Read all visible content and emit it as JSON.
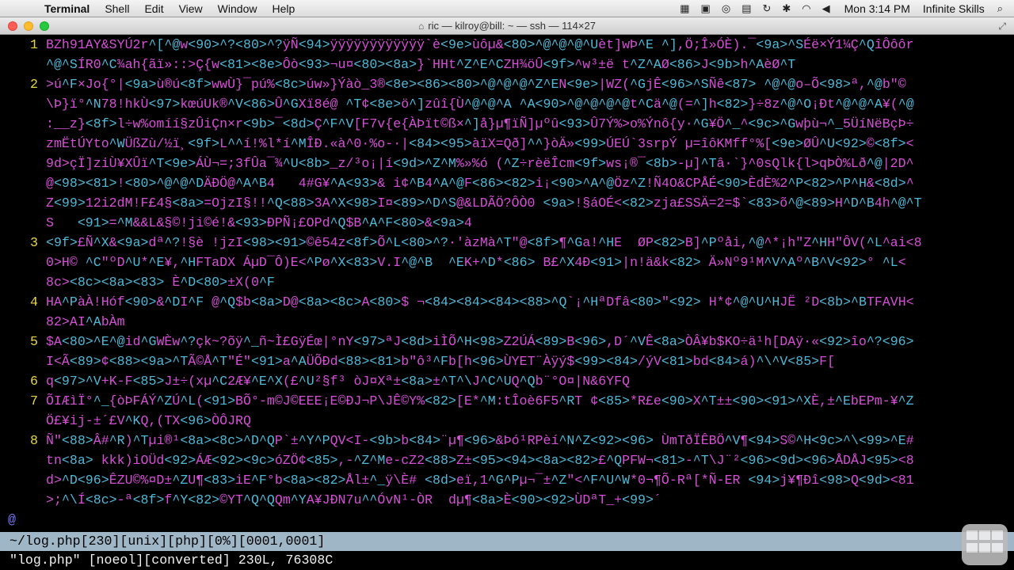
{
  "menubar": {
    "app": "Terminal",
    "items": [
      "Shell",
      "Edit",
      "View",
      "Window",
      "Help"
    ],
    "clock": "Mon 3:14 PM",
    "user": "Infinite Skills"
  },
  "window": {
    "title": "ric — kilroy@bill: ~ — ssh — 114×27"
  },
  "editor": {
    "lines": [
      {
        "n": "1",
        "text": "BZh91AY&SYÚ2r^[^@w<90>^?<80>^?ÿÑ<94>ÿÿÿÿÿÿÿÿÿÿÿÿ`è<9e>ùôµ&<80>^@^@^@^Uèt]wÞ^E ^],Ö;Î»ÓÈ).¯<9a>^SÉë×Ý1¼Ç^QîÔôôr"
      },
      {
        "n": "",
        "text": "^@^SÍR0^C¾ah{ãï»::>Ç{w<81><8e>Ôò<93>¬u¤<80><8a>}`HHt^Z^E^CZH¾öÛ<9f>^w³±ë t^Z^AØ<86>J<9b>h^AèØ^T"
      },
      {
        "n": "2",
        "text": ">ú^F×Jo{°|<9a>ù®ú<8f>wwÙ}¯pú%<8c>úw»}Ýàò_3®<8e><86><80>^@^@^@^Z^EN<9e>|WZ(^GjÊ<96>^SÑê<87> ^@^@o–Õ<98>ª,^@b\"©"
      },
      {
        "n": "",
        "text": "\\Þ}ï°^N78!hkÙ<97>kœúUk®^V<86>Û^GXï8é@ ^T¢<8e>ö^]zûî{Ù^@^@^A ^A<90>^@^@^@^@t^Cä^@(=^]h<82>}÷8z^@^O¡Ðt^@^@^A¥(^@"
      },
      {
        "n": "",
        "text": ":__z}<8f>l÷w%omíí§zÛiÇn×r<9b>¯<8d>Ç^F^V[F7v{e{ÀÞït©ß×^]å}µ¶ïÑ]µºû<93>Û7Ý%>o%Ýnô{y·^G¥Ö^_^<9c>^Gwþù¬^_5ÜíNëBçÞ÷"
      },
      {
        "n": "",
        "text": "zmËtÚYto^WÜßZù/½ï¸<9f>L^^í!%l*í^MÎÐ.«à^0·%o-·|<84><95>àïX=Qð]^^}òÄ»<99>ÚEÚ`3srpÝ µ=îôKMff°%[<9e>ØÛ^U<92>©<8f><"
      },
      {
        "n": "",
        "text": "9d>çÏ]ziÙ¥XÛï^T<9e>ÁÙ¬=;3fÛa¯¾^U<8b>_z/³o¡|í<9d>^Z^M%»%ó (^Z÷rèëÎcm<9f>ws¡®¯<8b>-µ]^Tâ·`}^0sQlk{l>qÞÒ%Lð^@|2D^"
      },
      {
        "n": "",
        "text": "@<98><81>!<80>^@^@^DÄÐÖ@^A^B4   4#G¥^A<93>& i¢^B4^A^@F<86><82>i¡<90>^A^@Öz^Z!Ñ4O&CPÅÉ<90>ÈdÈ%2^P<82>^P^H&<8d>^"
      },
      {
        "n": "",
        "text": "Z<99>12i2dM!F£4§<8a>=OjzI§!!^Q<88>3A^X<98>I¤<89>^D^S@&LDÃÖ?ÔÒ0 <9a>!§áOÉ<<82>zja£SSÄ=2=$`<83>õ^@<89>H^D^B4h^@^T"
      },
      {
        "n": "",
        "text": "S   <91>=^M&&L&§©!ji©é!&<93>ÐPÑ¡£OPd^Q$B^A^F<80>&<9a>4"
      },
      {
        "n": "3",
        "text": "<9f>£Ñ^X&<9a>dª^?!§è !jzI<98><91>©ê54z<8f>Õ^L<80>^?·'àzMà^T\"@<8f>¶^Ga!^HE  ØP<82>B]^Pºåi,^@^*¡h\"Z^HH\"ÔV(^L^ai<8"
      },
      {
        "n": "",
        "text": "0>H© ^C\"ºD^U*^E¥,^HFTaDX ÁµD¯Ô)E<^Pø^X<83>V.I^@^B  ^EK+^D*<86> B£^X4Ð<91>|n!ä&k<82> Ä»Nº9¹M^V^Aº^B^V<92>° ^L<"
      },
      {
        "n": "",
        "text": "8c><8c><8a><83> È^D<80>±X(0^F"
      },
      {
        "n": "4",
        "text": "HA^PàÀ!Hóf<90>&^DI^F @^Q$b<8a>D@<8a><8c>A<80>$ ¬<84><84><84><88>^Q`¡^HªDfâ<80>\"<92> H*¢^@^U^HJË ²D<8b>^BTFAVH<"
      },
      {
        "n": "",
        "text": "82>AI^AbÀm"
      },
      {
        "n": "5",
        "text": "$A<80>^E^@id^GWÈw^?çk~?õÿ^_ñ~Ì£GÿÉœ|°nY<97>ªJ<8d>iÌÕ^H<98>Z2ÚÁ<89>B<96>,D´^VÊ<8a>ÒÂ¥b$KO÷ä¹h[DAÿ·«<92>îo^?<96>"
      },
      {
        "n": "",
        "text": "I<Ã<89>¢<88><9a>^TÃ©Å^T\"É\"<91>a^AÜÕÐd<88><81>b\"ô³^Fb[h<96>ÙYET¨Àÿý$<99><84>/ýV<81>bd<84>á)^\\^V<85>F["
      },
      {
        "n": "6",
        "text": "q<97>^V+K-F<85>J±÷(xµ^C2Æ¥^E^X(£^U²§f³ òJ¤Xª±<8a>±^T^\\J^C^UQ^Qb¨°O¤|N&6YFQ"
      },
      {
        "n": "7",
        "text": "ÕIÆìÏ°^_{òÞFÁÝ^ZÚ^L(<91>BÕ°-m©J©EEE¡E©ÐJ¬P\\JÊ©Y%<82>[E*^M:tÎoè6F5^RT ¢<85>*R£e<90>X^T±±<90><91>^XÈ,±^EbEPm-¥^Z"
      },
      {
        "n": "",
        "text": "Ö£¥ij-±´£V^KQ,(TX<96>ÒÔJRQ"
      },
      {
        "n": "8",
        "text": "Ñ\"<88>Â#^R)^Tµi®¹<8a><8c>^D^QP`±^Y^PQV<I-<9b>b<84>¨µ¶<96>&Þó¹RPèí^N^Z<92><96> ÙmTðÏÊBÖ^V¶<94>S©^H<9c>^\\<99>^E#"
      },
      {
        "n": "",
        "text": "tn<8a> kkk)iOÜd<92>ÁÆ<92><9c>óZÖ¢<85>,-^Z^Me-cZ2<88>Z±<95><94><8a><82>£^QPFW¬<81>-^T\\J¨²<96><9d><96>ÅDÅJ<95><8"
      },
      {
        "n": "",
        "text": "d>^D<96>ÊZU©%¤D±^ZU¶<83>iE^F°b<8a><82>Ål±^_ÿ\\È# <8d>eï,1^G^Pµ¬¯±^Z\"<^F^U^W*0¬¶Õ-Rª[*Ñ-ER <94>j¥¶Ðî<98>Q<9d><81"
      },
      {
        "n": "",
        "text": ">;^\\Í<8c>-ª<8f>f^Y<82>©YT^Q^QQm^YA¥JÐN7u^^ÓvN¹-ÒR  dµ¶<8a>È<90><92>ÙDªT_+<99>´"
      }
    ],
    "tilde": "@",
    "status_line": "~/log.php[230][unix][php][0%][0001,0001]",
    "message": "\"log.php\" [noeol][converted] 230L, 76308C"
  }
}
